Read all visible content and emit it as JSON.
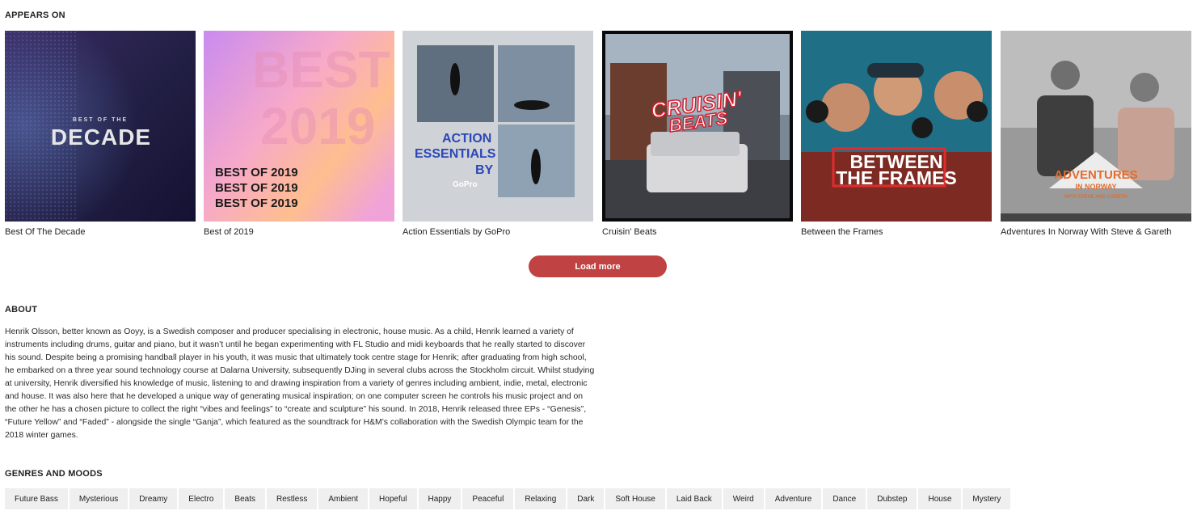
{
  "appears_on": {
    "heading": "APPEARS ON",
    "playlists": [
      {
        "title": "Best Of The Decade",
        "art": [
          "BEST OF THE",
          "DECADE"
        ]
      },
      {
        "title": "Best of 2019",
        "art": [
          "BEST OF 2019",
          "BEST OF 2019",
          "BEST OF 2019",
          "BEST",
          "2019"
        ]
      },
      {
        "title": "Action Essentials by GoPro",
        "art": [
          "ACTION",
          "ESSENTIALS",
          "BY",
          "GoPro"
        ]
      },
      {
        "title": "Cruisin' Beats",
        "art": [
          "CRUISIN'",
          "BEATS"
        ]
      },
      {
        "title": "Between the Frames",
        "art": [
          "BETWEEN",
          "THE FRAMES"
        ]
      },
      {
        "title": "Adventures In Norway With Steve & Gareth",
        "art": [
          "ADVENTURES",
          "IN NORWAY",
          "WITH STEVE AND GARETH"
        ]
      }
    ],
    "load_more_label": "Load more",
    "accent_color": "#c04242"
  },
  "about": {
    "heading": "ABOUT",
    "text": "Henrik Olsson, better known as Ooyy, is a Swedish composer and producer specialising in electronic, house music. As a child, Henrik learned a variety of instruments including drums, guitar and piano, but it wasn’t until he began experimenting with FL Studio and midi keyboards that he really started to discover his sound. Despite being a promising handball player in his youth, it was music that ultimately took centre stage for Henrik; after graduating from high school, he embarked on a three year sound technology course at Dalarna University, subsequently DJing in several clubs across the Stockholm circuit. Whilst studying at university, Henrik diversified his knowledge of music, listening to and drawing inspiration from a variety of genres including ambient, indie, metal, electronic and house. It was also here that he developed a unique way of generating musical inspiration; on one computer screen he controls his music project and on the other he has a chosen picture to collect the right “vibes and feelings” to “create and sculpture” his sound. In 2018, Henrik released three EPs - “Genesis”, “Future Yellow” and “Faded” - alongside the single “Ganja”, which featured as the soundtrack for H&M’s collaboration with the Swedish Olympic team for the 2018 winter games."
  },
  "genres": {
    "heading": "GENRES AND MOODS",
    "tags": [
      "Future Bass",
      "Mysterious",
      "Dreamy",
      "Electro",
      "Beats",
      "Restless",
      "Ambient",
      "Hopeful",
      "Happy",
      "Peaceful",
      "Relaxing",
      "Dark",
      "Soft House",
      "Laid Back",
      "Weird",
      "Adventure",
      "Dance",
      "Dubstep",
      "House",
      "Mystery"
    ]
  }
}
